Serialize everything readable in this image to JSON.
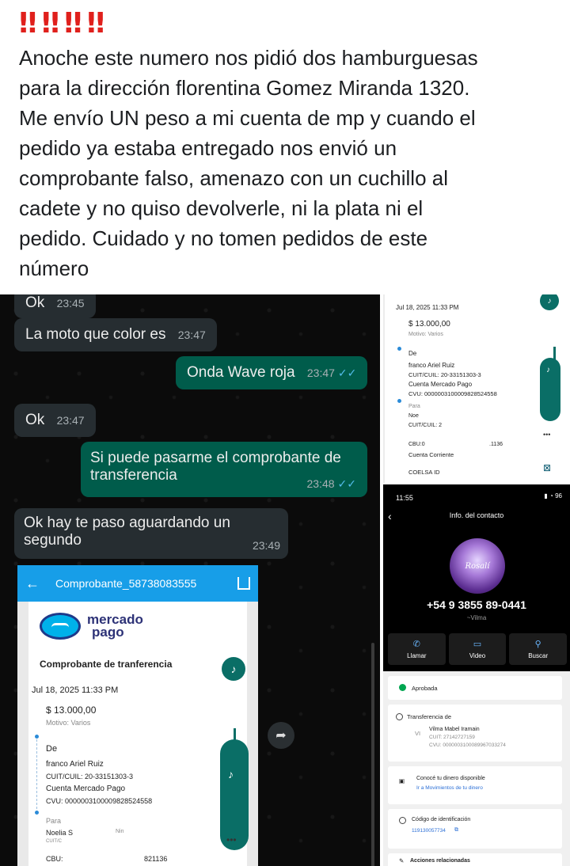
{
  "post": {
    "emoji": [
      "‼",
      "‼",
      "‼",
      "‼"
    ],
    "text": "Anoche este numero nos pidió dos hamburguesas\npara la dirección florentina Gomez Miranda 1320.\nMe envío UN peso a mi cuenta de mp y cuando el\npedido ya estaba entregado nos envió un\ncomprobante falso, amenazo con un cuchillo al\ncadete y no quiso devolverle, ni la plata ni el\npedido. Cuidado y no tomen pedidos de este\nnúmero"
  },
  "chat": {
    "messages": [
      {
        "dir": "in",
        "text": "Ok",
        "time": "23:45"
      },
      {
        "dir": "in",
        "text": "La moto que color es",
        "time": "23:47"
      },
      {
        "dir": "out",
        "text": "Onda Wave roja",
        "time": "23:47"
      },
      {
        "dir": "in",
        "text": "Ok",
        "time": "23:47"
      },
      {
        "dir": "out",
        "text_line1": "Si puede pasarme el comprobante de",
        "text_line2": "transferencia",
        "time": "23:48"
      },
      {
        "dir": "in",
        "text_line1": "Ok hay te paso aguardando un",
        "text_line2": "segundo",
        "time": "23:49"
      }
    ],
    "receipt": {
      "bar_title": "Comprobante_58738083555",
      "brand_top": "mercado",
      "brand_bottom": "pago",
      "title": "Comprobante de tranferencia",
      "date": "Jul 18, 2025 11:33 PM",
      "amount": "$ 13.000,00",
      "motive": "Motivo: Varios",
      "from_label": "De",
      "from_name": "franco Ariel Ruiz",
      "from_cuit": "CUIT/CUIL: 20-33151303-3",
      "from_account": "Cuenta Mercado Pago",
      "from_cvu": "CVU: 0000003100009828524558",
      "to_label": "Para",
      "to_name": "Noelia S",
      "to_name_tail": "Nin",
      "to_cuit": "CUIT/C",
      "cbu_label": "CBU:",
      "cbu_value": "821136"
    }
  },
  "receipt_top": {
    "date": "Jul 18, 2025 11:33 PM",
    "amount": "$ 13.000,00",
    "motive": "Motivo: Varios",
    "from_label": "De",
    "from_name": "franco Ariel Ruiz",
    "from_cuit": "CUIT/CUIL: 20-33151303-3",
    "from_account": "Cuenta Mercado Pago",
    "from_cvu": "CVU: 0000003100009828524558",
    "to_label": "Para",
    "to_name": "Noe",
    "to_cuit": "CUIT/CUIL: 2",
    "cbu": "CBU:0",
    "cbu_tail": ".1136",
    "account_type": "Cuenta Corriente",
    "coelsa": "COELSA ID"
  },
  "contact": {
    "time": "11:55",
    "status_icons": "96",
    "header": "Info. del contacto",
    "avatar_label": "Rosalí",
    "phone": "+54 9 3855 89-0441",
    "name": "~Vilma",
    "actions": [
      {
        "icon": "✆",
        "label": "Llamar"
      },
      {
        "icon": "▭",
        "label": "Video"
      },
      {
        "icon": "⚲",
        "label": "Buscar"
      }
    ]
  },
  "receipt_bottom": {
    "status": "Aprobada",
    "transfer_label": "Transferencia de",
    "sender_initials": "VI",
    "sender_name": "Vilma Mabel Iramain",
    "sender_cuit": "CUIT: 27142727159",
    "sender_cvu": "CVU: 0000003100089967033274",
    "money_title": "Conocé tu dinero disponible",
    "money_link": "Ir a Movimientos de tu dinero",
    "id_title": "Código de identificación",
    "id_value": "119130057734",
    "related": "Acciones relacionadas"
  },
  "colors": {
    "whatsapp_out": "#005c4b",
    "whatsapp_in": "#262d31",
    "mp_blue": "#179ee8",
    "alert_red": "#e0201c",
    "approved_green": "#00a650"
  }
}
